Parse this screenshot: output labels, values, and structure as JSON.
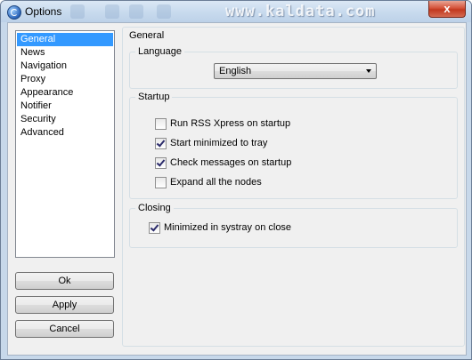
{
  "window": {
    "title": "Options",
    "watermark": "www.kaldata.com",
    "close_label": "x"
  },
  "nav": {
    "items": [
      {
        "label": "General",
        "selected": true
      },
      {
        "label": "News"
      },
      {
        "label": "Navigation"
      },
      {
        "label": "Proxy"
      },
      {
        "label": "Appearance"
      },
      {
        "label": "Notifier"
      },
      {
        "label": "Security"
      },
      {
        "label": "Advanced"
      }
    ]
  },
  "buttons": {
    "ok": "Ok",
    "apply": "Apply",
    "cancel": "Cancel"
  },
  "general": {
    "title": "General",
    "language": {
      "legend": "Language",
      "value": "English"
    },
    "startup": {
      "legend": "Startup",
      "options": [
        {
          "label": "Run RSS Xpress on startup",
          "checked": false
        },
        {
          "label": "Start minimized to tray",
          "checked": true
        },
        {
          "label": "Check messages on startup",
          "checked": true
        },
        {
          "label": "Expand all the nodes",
          "checked": false
        }
      ]
    },
    "closing": {
      "legend": "Closing",
      "options": [
        {
          "label": "Minimized in systray on close",
          "checked": true
        }
      ]
    }
  },
  "colors": {
    "selection": "#3399ff",
    "window_frame": "#c7d8ea",
    "close_button": "#c2391f"
  }
}
